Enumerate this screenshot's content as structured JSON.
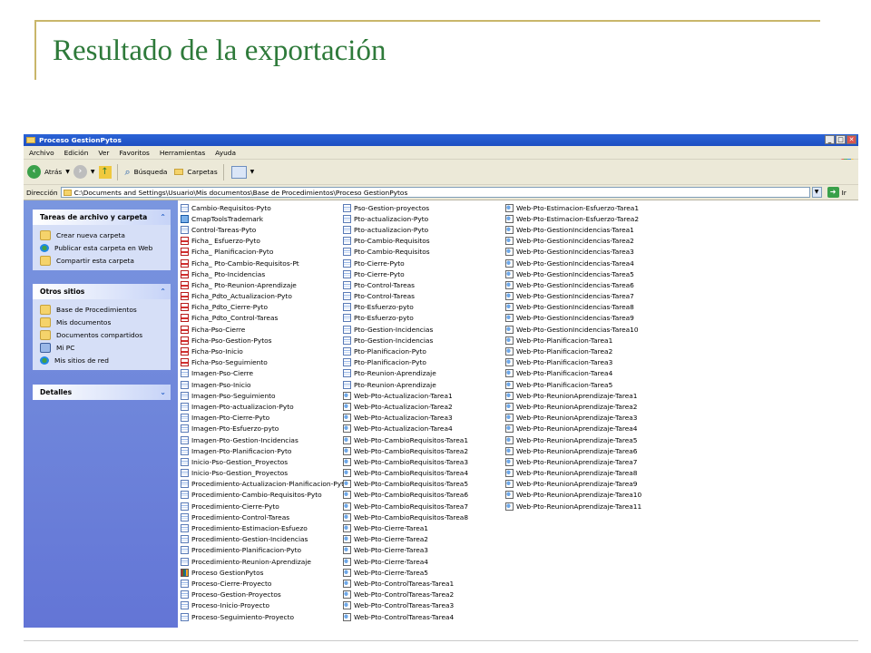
{
  "slide": {
    "title": "Resultado de la exportación",
    "accent_color": "#2e7a3a",
    "rule_color": "#c9b66a"
  },
  "window": {
    "title": "Proceso GestionPytos",
    "title_bar_color": "#2b63d6",
    "controls": [
      "_",
      "□",
      "✕"
    ],
    "menu": [
      "Archivo",
      "Edición",
      "Ver",
      "Favoritos",
      "Herramientas",
      "Ayuda"
    ],
    "toolbar": {
      "back_label": "Atrás",
      "search_label": "Búsqueda",
      "folders_label": "Carpetas"
    },
    "address": {
      "label": "Dirección",
      "value": "C:\\Documents and Settings\\Usuario\\Mis documentos\\Base de Procedimientos\\Proceso GestionPytos",
      "go_label": "Ir"
    }
  },
  "taskpane": {
    "panels": [
      {
        "title": "Tareas de archivo y carpeta",
        "items": [
          {
            "label": "Crear nueva carpeta",
            "icon": "new-folder-icon"
          },
          {
            "label": "Publicar esta carpeta en Web",
            "icon": "globe-icon"
          },
          {
            "label": "Compartir esta carpeta",
            "icon": "share-folder-icon"
          }
        ]
      },
      {
        "title": "Otros sitios",
        "items": [
          {
            "label": "Base de Procedimientos",
            "icon": "folder-icon"
          },
          {
            "label": "Mis documentos",
            "icon": "documents-icon"
          },
          {
            "label": "Documentos compartidos",
            "icon": "shared-documents-icon"
          },
          {
            "label": "Mi PC",
            "icon": "computer-icon"
          },
          {
            "label": "Mis sitios de red",
            "icon": "network-icon"
          }
        ]
      },
      {
        "title": "Detalles",
        "items": []
      }
    ]
  },
  "files": {
    "columns": [
      [
        {
          "name": "Cambio-Requisitos-Pyto",
          "type": "doc"
        },
        {
          "name": "CmapToolsTrademark",
          "type": "map"
        },
        {
          "name": "Control-Tareas-Pyto",
          "type": "doc"
        },
        {
          "name": "Ficha_ Esfuerzo-Pyto",
          "type": "pdf"
        },
        {
          "name": "Ficha_ Planificacion-Pyto",
          "type": "pdf"
        },
        {
          "name": "Ficha_ Pto-Cambio-Requisitos-Pt",
          "type": "pdf"
        },
        {
          "name": "Ficha_ Pto-Incidencias",
          "type": "pdf"
        },
        {
          "name": "Ficha_ Pto-Reunion-Aprendizaje",
          "type": "pdf"
        },
        {
          "name": "Ficha_Pdto_Actualizacion-Pyto",
          "type": "pdf"
        },
        {
          "name": "Ficha_Pdto_Cierre-Pyto",
          "type": "pdf"
        },
        {
          "name": "Ficha_Pdto_Control-Tareas",
          "type": "pdf"
        },
        {
          "name": "Ficha-Pso-Cierre",
          "type": "pdf"
        },
        {
          "name": "Ficha-Pso-Gestion-Pytos",
          "type": "pdf"
        },
        {
          "name": "Ficha-Pso-Inicio",
          "type": "pdf"
        },
        {
          "name": "Ficha-Pso-Seguimiento",
          "type": "pdf"
        },
        {
          "name": "Imagen-Pso-Cierre",
          "type": "doc"
        },
        {
          "name": "Imagen-Pso-Inicio",
          "type": "doc"
        },
        {
          "name": "Imagen-Pso-Seguimiento",
          "type": "doc"
        },
        {
          "name": "Imagen-Pto-actualizacion-Pyto",
          "type": "doc"
        },
        {
          "name": "Imagen-Pto-Cierre-Pyto",
          "type": "doc"
        },
        {
          "name": "Imagen-Pto-Esfuerzo-pyto",
          "type": "doc"
        },
        {
          "name": "Imagen-Pto-Gestion-Incidencias",
          "type": "doc"
        },
        {
          "name": "Imagen-Pto-Planificacion-Pyto",
          "type": "doc"
        },
        {
          "name": "Inicio-Pso-Gestion_Proyectos",
          "type": "doc"
        },
        {
          "name": "Inicio-Pso-Gestion_Proyectos",
          "type": "doc"
        },
        {
          "name": "Procedimiento-Actualizacion-Planificacion-Pyto",
          "type": "doc"
        },
        {
          "name": "Procedimiento-Cambio-Requisitos-Pyto",
          "type": "doc"
        },
        {
          "name": "Procedimiento-Cierre-Pyto",
          "type": "doc"
        },
        {
          "name": "Procedimiento-Control-Tareas",
          "type": "doc"
        },
        {
          "name": "Procedimiento-Estimacion-Esfuezo",
          "type": "doc"
        },
        {
          "name": "Procedimiento-Gestion-Incidencias",
          "type": "doc"
        },
        {
          "name": "Procedimiento-Planificacion-Pyto",
          "type": "doc"
        },
        {
          "name": "Procedimiento-Reunion-Aprendizaje",
          "type": "doc"
        },
        {
          "name": "Proceso GestionPytos",
          "type": "win"
        },
        {
          "name": "Proceso-Cierre-Proyecto",
          "type": "doc"
        },
        {
          "name": "Proceso-Gestion-Proyectos",
          "type": "doc"
        },
        {
          "name": "Proceso-Inicio-Proyecto",
          "type": "doc"
        },
        {
          "name": "Proceso-Seguimiento-Proyecto",
          "type": "doc"
        }
      ],
      [
        {
          "name": "Pso-Gestion-proyectos",
          "type": "doc"
        },
        {
          "name": "Pto-actualizacion-Pyto",
          "type": "doc"
        },
        {
          "name": "Pto-actualizacion-Pyto",
          "type": "doc"
        },
        {
          "name": "Pto-Cambio-Requisitos",
          "type": "doc"
        },
        {
          "name": "Pto-Cambio-Requisitos",
          "type": "doc"
        },
        {
          "name": "Pto-Cierre-Pyto",
          "type": "doc"
        },
        {
          "name": "Pto-Cierre-Pyto",
          "type": "doc"
        },
        {
          "name": "Pto-Control-Tareas",
          "type": "doc"
        },
        {
          "name": "Pto-Control-Tareas",
          "type": "doc"
        },
        {
          "name": "Pto-Esfuerzo-pyto",
          "type": "doc"
        },
        {
          "name": "Pto-Esfuerzo-pyto",
          "type": "doc"
        },
        {
          "name": "Pto-Gestion-Incidencias",
          "type": "doc"
        },
        {
          "name": "Pto-Gestion-Incidencias",
          "type": "doc"
        },
        {
          "name": "Pto-Planificacion-Pyto",
          "type": "doc"
        },
        {
          "name": "Pto-Planificacion-Pyto",
          "type": "doc"
        },
        {
          "name": "Pto-Reunion-Aprendizaje",
          "type": "doc"
        },
        {
          "name": "Pto-Reunion-Aprendizaje",
          "type": "doc"
        },
        {
          "name": "Web-Pto-Actualizacion-Tarea1",
          "type": "htm"
        },
        {
          "name": "Web-Pto-Actualizacion-Tarea2",
          "type": "htm"
        },
        {
          "name": "Web-Pto-Actualizacion-Tarea3",
          "type": "htm"
        },
        {
          "name": "Web-Pto-Actualizacion-Tarea4",
          "type": "htm"
        },
        {
          "name": "Web-Pto-CambioRequisitos-Tarea1",
          "type": "htm"
        },
        {
          "name": "Web-Pto-CambioRequisitos-Tarea2",
          "type": "htm"
        },
        {
          "name": "Web-Pto-CambioRequisitos-Tarea3",
          "type": "htm"
        },
        {
          "name": "Web-Pto-CambioRequisitos-Tarea4",
          "type": "htm"
        },
        {
          "name": "Web-Pto-CambioRequisitos-Tarea5",
          "type": "htm"
        },
        {
          "name": "Web-Pto-CambioRequisitos-Tarea6",
          "type": "htm"
        },
        {
          "name": "Web-Pto-CambioRequisitos-Tarea7",
          "type": "htm"
        },
        {
          "name": "Web-Pto-CambioRequisitos-Tarea8",
          "type": "htm"
        },
        {
          "name": "Web-Pto-Cierre-Tarea1",
          "type": "htm"
        },
        {
          "name": "Web-Pto-Cierre-Tarea2",
          "type": "htm"
        },
        {
          "name": "Web-Pto-Cierre-Tarea3",
          "type": "htm"
        },
        {
          "name": "Web-Pto-Cierre-Tarea4",
          "type": "htm"
        },
        {
          "name": "Web-Pto-Cierre-Tarea5",
          "type": "htm"
        },
        {
          "name": "Web-Pto-ControlTareas-Tarea1",
          "type": "htm"
        },
        {
          "name": "Web-Pto-ControlTareas-Tarea2",
          "type": "htm"
        },
        {
          "name": "Web-Pto-ControlTareas-Tarea3",
          "type": "htm"
        },
        {
          "name": "Web-Pto-ControlTareas-Tarea4",
          "type": "htm"
        }
      ],
      [
        {
          "name": "Web-Pto-Estimacion-Esfuerzo-Tarea1",
          "type": "htm"
        },
        {
          "name": "Web-Pto-Estimacion-Esfuerzo-Tarea2",
          "type": "htm"
        },
        {
          "name": "Web-Pto-GestionIncidencias-Tarea1",
          "type": "htm"
        },
        {
          "name": "Web-Pto-GestionIncidencias-Tarea2",
          "type": "htm"
        },
        {
          "name": "Web-Pto-GestionIncidencias-Tarea3",
          "type": "htm"
        },
        {
          "name": "Web-Pto-GestionIncidencias-Tarea4",
          "type": "htm"
        },
        {
          "name": "Web-Pto-GestionIncidencias-Tarea5",
          "type": "htm"
        },
        {
          "name": "Web-Pto-GestionIncidencias-Tarea6",
          "type": "htm"
        },
        {
          "name": "Web-Pto-GestionIncidencias-Tarea7",
          "type": "htm"
        },
        {
          "name": "Web-Pto-GestionIncidencias-Tarea8",
          "type": "htm"
        },
        {
          "name": "Web-Pto-GestionIncidencias-Tarea9",
          "type": "htm"
        },
        {
          "name": "Web-Pto-GestionIncidencias-Tarea10",
          "type": "htm"
        },
        {
          "name": "Web-Pto-Planificacion-Tarea1",
          "type": "htm"
        },
        {
          "name": "Web-Pto-Planificacion-Tarea2",
          "type": "htm"
        },
        {
          "name": "Web-Pto-Planificacion-Tarea3",
          "type": "htm"
        },
        {
          "name": "Web-Pto-Planificacion-Tarea4",
          "type": "htm"
        },
        {
          "name": "Web-Pto-Planificacion-Tarea5",
          "type": "htm"
        },
        {
          "name": "Web-Pto-ReunionAprendizaje-Tarea1",
          "type": "htm"
        },
        {
          "name": "Web-Pto-ReunionAprendizaje-Tarea2",
          "type": "htm"
        },
        {
          "name": "Web-Pto-ReunionAprendizaje-Tarea3",
          "type": "htm"
        },
        {
          "name": "Web-Pto-ReunionAprendizaje-Tarea4",
          "type": "htm"
        },
        {
          "name": "Web-Pto-ReunionAprendizaje-Tarea5",
          "type": "htm"
        },
        {
          "name": "Web-Pto-ReunionAprendizaje-Tarea6",
          "type": "htm"
        },
        {
          "name": "Web-Pto-ReunionAprendizaje-Tarea7",
          "type": "htm"
        },
        {
          "name": "Web-Pto-ReunionAprendizaje-Tarea8",
          "type": "htm"
        },
        {
          "name": "Web-Pto-ReunionAprendizaje-Tarea9",
          "type": "htm"
        },
        {
          "name": "Web-Pto-ReunionAprendizaje-Tarea10",
          "type": "htm"
        },
        {
          "name": "Web-Pto-ReunionAprendizaje-Tarea11",
          "type": "htm"
        }
      ]
    ]
  }
}
